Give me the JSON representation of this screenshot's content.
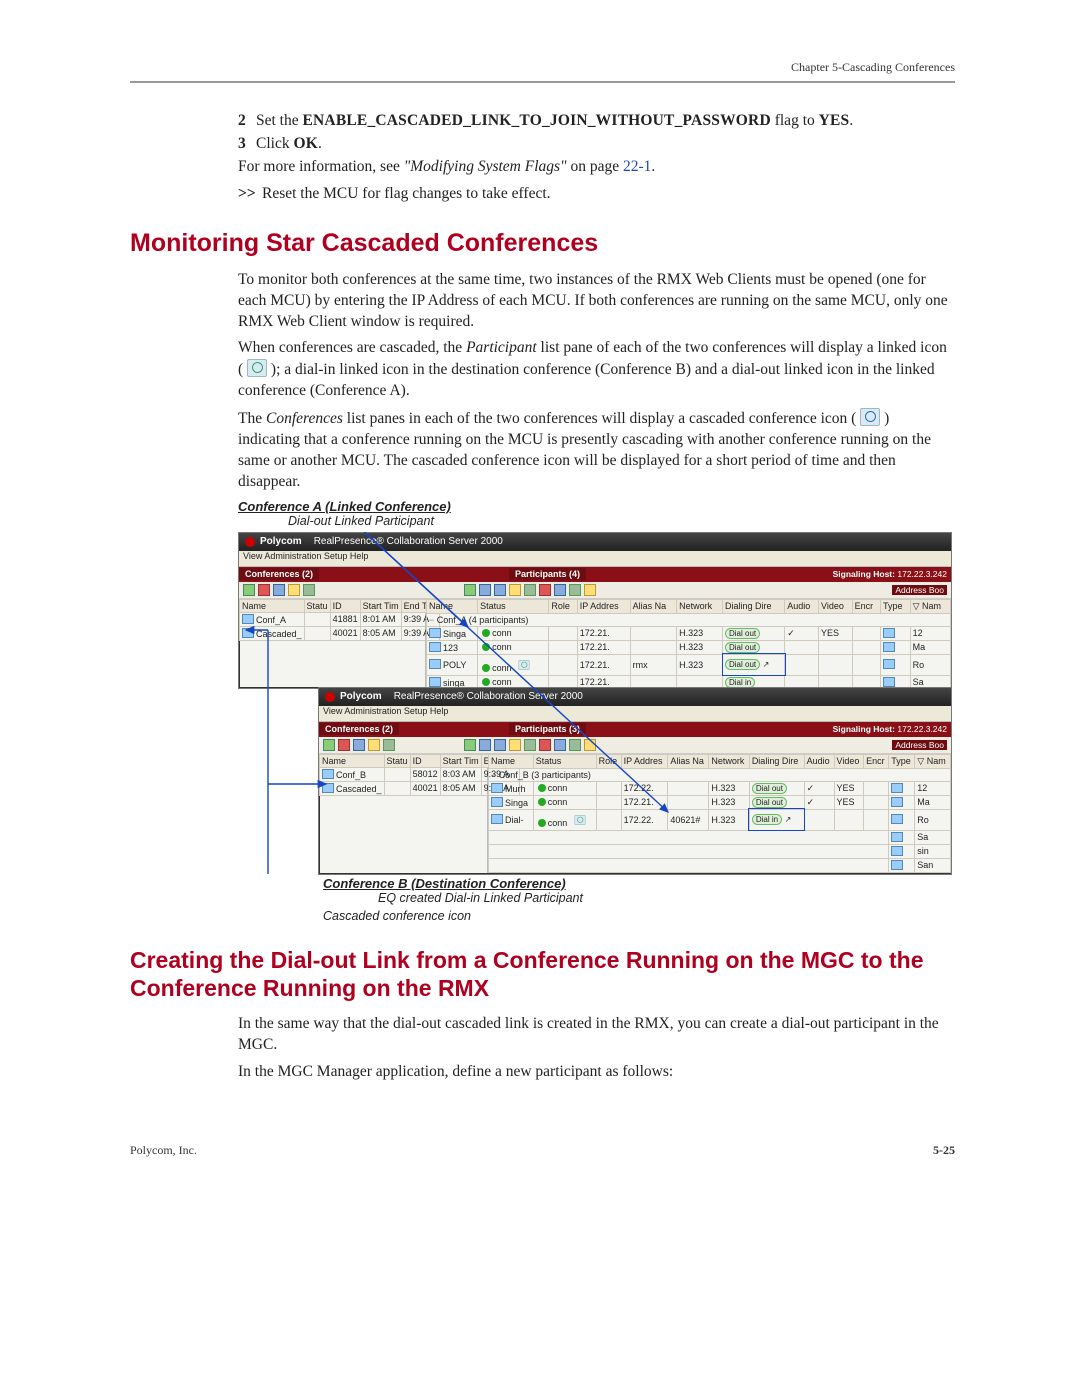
{
  "chapter_head": "Chapter 5-Cascading Conferences",
  "step2": {
    "num": "2",
    "pre": "Set the ",
    "flag": "ENABLE_CASCADED_LINK_TO_JOIN_WITHOUT_PASSWORD",
    "post": " flag to ",
    "yes": "YES",
    "dot": "."
  },
  "step3": {
    "num": "3",
    "pre": "Click ",
    "ok": "OK",
    "dot": "."
  },
  "more_info": {
    "pre": "For more information, see ",
    "link_i": "\"Modifying System Flags\"",
    "post": " on page ",
    "page": "22-1",
    "dot": "."
  },
  "reset": {
    "pp": ">>",
    "t": "  Reset the MCU for flag changes to take effect."
  },
  "h_monitor": "Monitoring Star Cascaded Conferences",
  "para_mon1": "To monitor both conferences at the same time, two instances of the RMX Web Clients must be opened (one for each MCU) by entering the IP Address of each MCU. If both conferences are running on the same MCU, only one RMX Web Client window is required.",
  "para_mon2": {
    "a": "When conferences are cascaded, the ",
    "i": "Participant",
    "b": " list pane of each of the two conferences will display a linked icon (",
    "c": "); a dial-in linked icon in the destination conference (Conference B) and a dial-out linked icon in the linked conference (Conference A)."
  },
  "para_mon3": {
    "a": "The ",
    "i": "Conferences",
    "b1": " list panes in each of the two conferences will display a cascaded conference icon (",
    "b2": ") indicating that a conference running on the MCU is presently cascading with another conference running on the same or another MCU. The cascaded conference icon will be displayed for a short period of time and then disappear."
  },
  "fig": {
    "confA_label": "Conference A (Linked Conference)",
    "confA_sub": "Dial-out Linked Participant",
    "confB_label": "Conference B (Destination Conference)",
    "confB_sub": "EQ created Dial-in Linked Participant",
    "casc_note": "Cascaded conference icon"
  },
  "rmx": {
    "title": "RealPresence® Collaboration Server 2000",
    "brand": "Polycom",
    "menu": "View   Administration   Setup   Help",
    "sig_label": "Signaling Host:",
    "sig_ip": "172.22.3.242",
    "tab_left_a": "Conferences (2)",
    "tab_right_a": "Participants (4)",
    "tab_left_b": "Conferences (2)",
    "tab_right_b": "Participants (3)",
    "addr_tab": "Address Boo",
    "left_headers": [
      "Name",
      "Statu",
      "ID",
      "Start Tim",
      "End Tim"
    ],
    "right_headers": [
      "Name",
      "Status",
      "Role",
      "IP Addres",
      "Alias Na",
      "Network",
      "Dialing Dire",
      "Audio",
      "Video",
      "Encr",
      "Type",
      "▽ Nam"
    ],
    "confA_rows": [
      {
        "name": "Conf_A",
        "id": "41881",
        "start": "8:01 AM",
        "end": "9:39 A"
      },
      {
        "name": "Cascaded_",
        "id": "40021",
        "start": "8:05 AM",
        "end": "9:39 A"
      }
    ],
    "confA_parts_title": "Conf_A (4 participants)",
    "confA_parts": [
      {
        "name": "Singa",
        "stat": "conn",
        "ip": "172.21.",
        "net": "H.323",
        "dir": "Dial out",
        "a": "✓",
        "v": "YES",
        "type": "12"
      },
      {
        "name": "123",
        "stat": "conn",
        "ip": "172.21.",
        "net": "H.323",
        "dir": "Dial out",
        "a": "",
        "v": "",
        "type": "Ma"
      },
      {
        "name": "POLY",
        "stat": "conn",
        "ip": "172.21.",
        "alias": "rmx",
        "net": "H.323",
        "dir": "Dial out",
        "linked": "yes",
        "type": "Ro"
      },
      {
        "name": "singa",
        "stat": "conn",
        "ip": "172.21.",
        "net": "",
        "dir": "Dial in",
        "type": "Sa"
      }
    ],
    "confB_rows": [
      {
        "name": "Conf_B",
        "id": "58012",
        "start": "8:03 AM",
        "end": "9:39 A"
      },
      {
        "name": "Cascaded_",
        "id": "40021",
        "start": "8:05 AM",
        "end": "9:39 A"
      }
    ],
    "confB_parts_title": "Conf_B (3 participants)",
    "confB_parts": [
      {
        "name": "Murh",
        "stat": "conn",
        "ip": "172.22.",
        "net": "H.323",
        "dir": "Dial out",
        "a": "✓",
        "v": "YES",
        "type": "12"
      },
      {
        "name": "Singa",
        "stat": "conn",
        "ip": "172.21.",
        "net": "H.323",
        "dir": "Dial out",
        "a": "✓",
        "v": "YES",
        "type": "Ma"
      },
      {
        "name": "Dial-",
        "stat": "conn",
        "ip": "172.22.",
        "alias": "40621#",
        "net": "H.323",
        "dir": "Dial in",
        "linked": "yes",
        "type": "Ro"
      }
    ],
    "extra_types": [
      "Sa",
      "sin",
      "San"
    ]
  },
  "h_create": "Creating the Dial-out Link from a Conference Running on the MGC to the Conference Running on the RMX",
  "para_c1": "In the same way that the dial-out cascaded link is created in the RMX, you can create a dial-out participant in the MGC.",
  "para_c2": "In the MGC Manager application, define a new participant as follows:",
  "footer_left": "Polycom, Inc.",
  "footer_right": "5-25"
}
